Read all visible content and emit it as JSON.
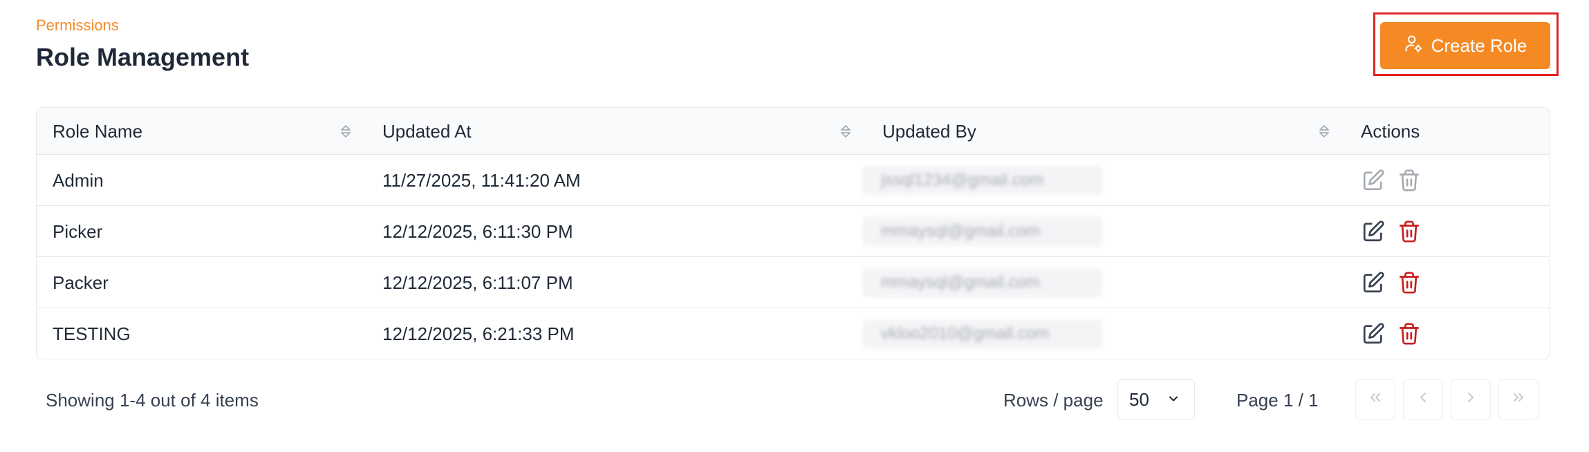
{
  "header": {
    "breadcrumb": "Permissions",
    "title": "Role Management",
    "create_label": "Create Role"
  },
  "table": {
    "columns": [
      "Role Name",
      "Updated At",
      "Updated By",
      "Actions"
    ],
    "rows": [
      {
        "name": "Admin",
        "updated_at": "11/27/2025, 11:41:20 AM",
        "updated_by": "jssql1234@gmail.com",
        "actions_enabled": false
      },
      {
        "name": "Picker",
        "updated_at": "12/12/2025, 6:11:30 PM",
        "updated_by": "mmaysql@gmail.com",
        "actions_enabled": true
      },
      {
        "name": "Packer",
        "updated_at": "12/12/2025, 6:11:07 PM",
        "updated_by": "mmaysql@gmail.com",
        "actions_enabled": true
      },
      {
        "name": "TESTING",
        "updated_at": "12/12/2025, 6:21:33 PM",
        "updated_by": "vkloo2010@gmail.com",
        "actions_enabled": true
      }
    ]
  },
  "footer": {
    "showing": "Showing 1-4 out of 4 items",
    "rows_per_page_label": "Rows / page",
    "rows_per_page_value": "50",
    "page_info": "Page 1 / 1"
  },
  "colors": {
    "accent": "#f58a25",
    "highlight_frame": "#e02424",
    "delete": "#c81e1e",
    "edit": "#374151",
    "disabled": "#9ca3af"
  },
  "icons": {
    "create": "user-gear-icon",
    "sort": "sort-icon",
    "edit": "edit-icon",
    "delete": "trash-icon",
    "select": "chevron-down-icon",
    "first": "chevrons-left-icon",
    "prev": "chevron-left-icon",
    "next": "chevron-right-icon",
    "last": "chevrons-right-icon"
  }
}
